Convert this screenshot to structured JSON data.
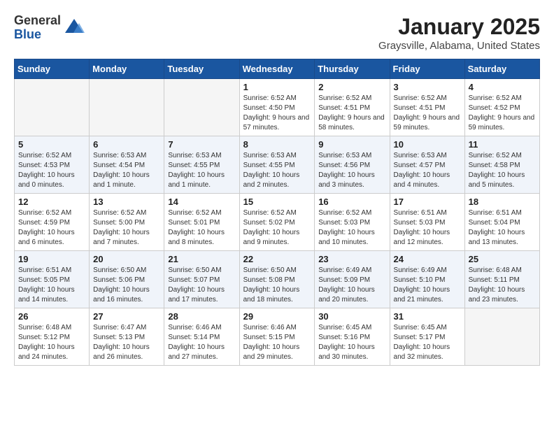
{
  "header": {
    "logo_general": "General",
    "logo_blue": "Blue",
    "month_title": "January 2025",
    "location": "Graysville, Alabama, United States"
  },
  "weekdays": [
    "Sunday",
    "Monday",
    "Tuesday",
    "Wednesday",
    "Thursday",
    "Friday",
    "Saturday"
  ],
  "weeks": [
    [
      {
        "day": "",
        "info": ""
      },
      {
        "day": "",
        "info": ""
      },
      {
        "day": "",
        "info": ""
      },
      {
        "day": "1",
        "info": "Sunrise: 6:52 AM\nSunset: 4:50 PM\nDaylight: 9 hours and 57 minutes."
      },
      {
        "day": "2",
        "info": "Sunrise: 6:52 AM\nSunset: 4:51 PM\nDaylight: 9 hours and 58 minutes."
      },
      {
        "day": "3",
        "info": "Sunrise: 6:52 AM\nSunset: 4:51 PM\nDaylight: 9 hours and 59 minutes."
      },
      {
        "day": "4",
        "info": "Sunrise: 6:52 AM\nSunset: 4:52 PM\nDaylight: 9 hours and 59 minutes."
      }
    ],
    [
      {
        "day": "5",
        "info": "Sunrise: 6:52 AM\nSunset: 4:53 PM\nDaylight: 10 hours and 0 minutes."
      },
      {
        "day": "6",
        "info": "Sunrise: 6:53 AM\nSunset: 4:54 PM\nDaylight: 10 hours and 1 minute."
      },
      {
        "day": "7",
        "info": "Sunrise: 6:53 AM\nSunset: 4:55 PM\nDaylight: 10 hours and 1 minute."
      },
      {
        "day": "8",
        "info": "Sunrise: 6:53 AM\nSunset: 4:55 PM\nDaylight: 10 hours and 2 minutes."
      },
      {
        "day": "9",
        "info": "Sunrise: 6:53 AM\nSunset: 4:56 PM\nDaylight: 10 hours and 3 minutes."
      },
      {
        "day": "10",
        "info": "Sunrise: 6:53 AM\nSunset: 4:57 PM\nDaylight: 10 hours and 4 minutes."
      },
      {
        "day": "11",
        "info": "Sunrise: 6:52 AM\nSunset: 4:58 PM\nDaylight: 10 hours and 5 minutes."
      }
    ],
    [
      {
        "day": "12",
        "info": "Sunrise: 6:52 AM\nSunset: 4:59 PM\nDaylight: 10 hours and 6 minutes."
      },
      {
        "day": "13",
        "info": "Sunrise: 6:52 AM\nSunset: 5:00 PM\nDaylight: 10 hours and 7 minutes."
      },
      {
        "day": "14",
        "info": "Sunrise: 6:52 AM\nSunset: 5:01 PM\nDaylight: 10 hours and 8 minutes."
      },
      {
        "day": "15",
        "info": "Sunrise: 6:52 AM\nSunset: 5:02 PM\nDaylight: 10 hours and 9 minutes."
      },
      {
        "day": "16",
        "info": "Sunrise: 6:52 AM\nSunset: 5:03 PM\nDaylight: 10 hours and 10 minutes."
      },
      {
        "day": "17",
        "info": "Sunrise: 6:51 AM\nSunset: 5:03 PM\nDaylight: 10 hours and 12 minutes."
      },
      {
        "day": "18",
        "info": "Sunrise: 6:51 AM\nSunset: 5:04 PM\nDaylight: 10 hours and 13 minutes."
      }
    ],
    [
      {
        "day": "19",
        "info": "Sunrise: 6:51 AM\nSunset: 5:05 PM\nDaylight: 10 hours and 14 minutes."
      },
      {
        "day": "20",
        "info": "Sunrise: 6:50 AM\nSunset: 5:06 PM\nDaylight: 10 hours and 16 minutes."
      },
      {
        "day": "21",
        "info": "Sunrise: 6:50 AM\nSunset: 5:07 PM\nDaylight: 10 hours and 17 minutes."
      },
      {
        "day": "22",
        "info": "Sunrise: 6:50 AM\nSunset: 5:08 PM\nDaylight: 10 hours and 18 minutes."
      },
      {
        "day": "23",
        "info": "Sunrise: 6:49 AM\nSunset: 5:09 PM\nDaylight: 10 hours and 20 minutes."
      },
      {
        "day": "24",
        "info": "Sunrise: 6:49 AM\nSunset: 5:10 PM\nDaylight: 10 hours and 21 minutes."
      },
      {
        "day": "25",
        "info": "Sunrise: 6:48 AM\nSunset: 5:11 PM\nDaylight: 10 hours and 23 minutes."
      }
    ],
    [
      {
        "day": "26",
        "info": "Sunrise: 6:48 AM\nSunset: 5:12 PM\nDaylight: 10 hours and 24 minutes."
      },
      {
        "day": "27",
        "info": "Sunrise: 6:47 AM\nSunset: 5:13 PM\nDaylight: 10 hours and 26 minutes."
      },
      {
        "day": "28",
        "info": "Sunrise: 6:46 AM\nSunset: 5:14 PM\nDaylight: 10 hours and 27 minutes."
      },
      {
        "day": "29",
        "info": "Sunrise: 6:46 AM\nSunset: 5:15 PM\nDaylight: 10 hours and 29 minutes."
      },
      {
        "day": "30",
        "info": "Sunrise: 6:45 AM\nSunset: 5:16 PM\nDaylight: 10 hours and 30 minutes."
      },
      {
        "day": "31",
        "info": "Sunrise: 6:45 AM\nSunset: 5:17 PM\nDaylight: 10 hours and 32 minutes."
      },
      {
        "day": "",
        "info": ""
      }
    ]
  ]
}
